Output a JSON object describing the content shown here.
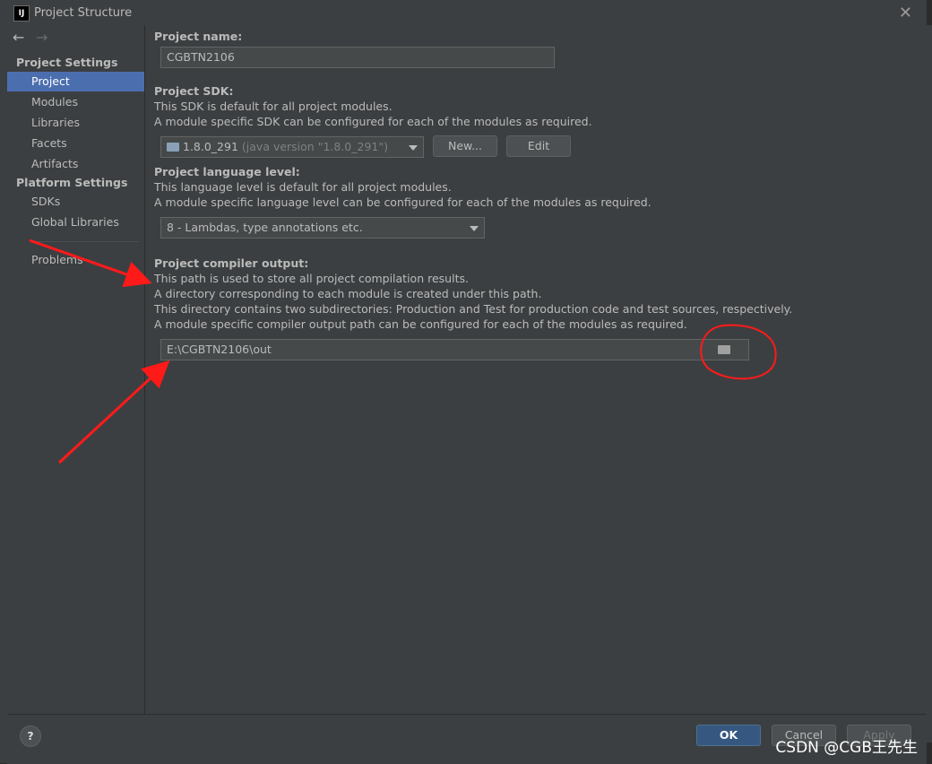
{
  "window": {
    "title": "Project Structure",
    "icon_label": "IJ"
  },
  "sidebar": {
    "project_settings": "Project Settings",
    "items": [
      "Project",
      "Modules",
      "Libraries",
      "Facets",
      "Artifacts"
    ],
    "platform_settings": "Platform Settings",
    "platform_items": [
      "SDKs",
      "Global Libraries"
    ],
    "problems": "Problems"
  },
  "project": {
    "name_label": "Project name:",
    "name_value": "CGBTN2106",
    "sdk_label": "Project SDK:",
    "sdk_desc1": "This SDK is default for all project modules.",
    "sdk_desc2": "A module specific SDK can be configured for each of the modules as required.",
    "sdk_value": "1.8.0_291",
    "sdk_version": "(java version \"1.8.0_291\")",
    "new_button": "New...",
    "edit_button": "Edit",
    "lang_label": "Project language level:",
    "lang_desc1": "This language level is default for all project modules.",
    "lang_desc2": "A module specific language level can be configured for each of the modules as required.",
    "lang_value": "8 - Lambdas, type annotations etc.",
    "output_label": "Project compiler output:",
    "output_desc1": "This path is used to store all project compilation results.",
    "output_desc2": "A directory corresponding to each module is created under this path.",
    "output_desc3": "This directory contains two subdirectories: Production and Test for production code and test sources, respectively.",
    "output_desc4": "A module specific compiler output path can be configured for each of the modules as required.",
    "output_value": "E:\\CGBTN2106\\out"
  },
  "footer": {
    "help": "?",
    "ok": "OK",
    "cancel": "Cancel",
    "apply": "Apply"
  },
  "watermark": "CSDN @CGB王先生",
  "colors": {
    "accent": "#4b6eaf",
    "annotation": "#ff1a1a"
  }
}
